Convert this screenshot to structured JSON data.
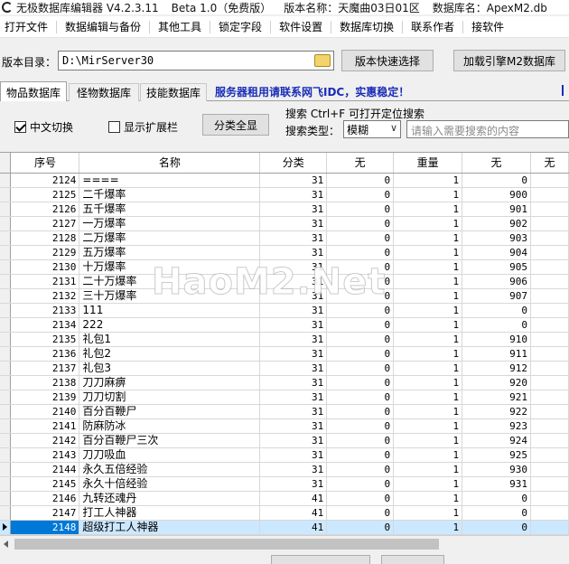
{
  "titlebar": {
    "app": "无极数据库编辑器 V4.2.3.11",
    "beta": "Beta 1.0（免费版）",
    "version_name": "版本名称：天魔曲03日01区",
    "db_name": "数据库名：ApexM2.db"
  },
  "menu": [
    "打开文件",
    "数据编辑与备份",
    "其他工具",
    "锁定字段",
    "软件设置",
    "数据库切换",
    "联系作者",
    "接软件"
  ],
  "directory": {
    "label": "版本目录：",
    "value": "D:\\MirServer30",
    "quick_select_label": "版本快速选择",
    "load_engine_label": "加载引擎M2数据库"
  },
  "tabs": [
    "物品数据库",
    "怪物数据库",
    "技能数据库"
  ],
  "banner": "服务器租用请联系网飞IDC，实惠稳定！",
  "options": {
    "chinese_toggle": "中文切换",
    "chinese_checked": true,
    "show_extension": "显示扩展栏",
    "show_extension_checked": false,
    "show_all_button": "分类全显"
  },
  "search": {
    "caption": "搜索  Ctrl+F 可打开定位搜索",
    "type_label": "搜索类型：",
    "type_value": "模糊",
    "placeholder": "请输入需要搜索的内容"
  },
  "table": {
    "columns": [
      "序号",
      "名称",
      "分类",
      "无",
      "重量",
      "无",
      "无"
    ],
    "rows": [
      [
        "2124",
        "====",
        "31",
        "0",
        "1",
        "0"
      ],
      [
        "2125",
        "二千爆率",
        "31",
        "0",
        "1",
        "900"
      ],
      [
        "2126",
        "五千爆率",
        "31",
        "0",
        "1",
        "901"
      ],
      [
        "2127",
        "一万爆率",
        "31",
        "0",
        "1",
        "902"
      ],
      [
        "2128",
        "二万爆率",
        "31",
        "0",
        "1",
        "903"
      ],
      [
        "2129",
        "五万爆率",
        "31",
        "0",
        "1",
        "904"
      ],
      [
        "2130",
        "十万爆率",
        "31",
        "0",
        "1",
        "905"
      ],
      [
        "2131",
        "二十万爆率",
        "31",
        "0",
        "1",
        "906"
      ],
      [
        "2132",
        "三十万爆率",
        "31",
        "0",
        "1",
        "907"
      ],
      [
        "2133",
        "111",
        "31",
        "0",
        "1",
        "0"
      ],
      [
        "2134",
        "222",
        "31",
        "0",
        "1",
        "0"
      ],
      [
        "2135",
        "礼包1",
        "31",
        "0",
        "1",
        "910"
      ],
      [
        "2136",
        "礼包2",
        "31",
        "0",
        "1",
        "911"
      ],
      [
        "2137",
        "礼包3",
        "31",
        "0",
        "1",
        "912"
      ],
      [
        "2138",
        "刀刀麻痹",
        "31",
        "0",
        "1",
        "920"
      ],
      [
        "2139",
        "刀刀切割",
        "31",
        "0",
        "1",
        "921"
      ],
      [
        "2140",
        "百分百鞭尸",
        "31",
        "0",
        "1",
        "922"
      ],
      [
        "2141",
        "防麻防冰",
        "31",
        "0",
        "1",
        "923"
      ],
      [
        "2142",
        "百分百鞭尸三次",
        "31",
        "0",
        "1",
        "924"
      ],
      [
        "2143",
        "刀刀吸血",
        "31",
        "0",
        "1",
        "925"
      ],
      [
        "2144",
        "永久五倍经验",
        "31",
        "0",
        "1",
        "930"
      ],
      [
        "2145",
        "永久十倍经验",
        "31",
        "0",
        "1",
        "931"
      ],
      [
        "2146",
        "九转还魂丹",
        "41",
        "0",
        "1",
        "0"
      ],
      [
        "2147",
        "打工人神器",
        "41",
        "0",
        "1",
        "0"
      ],
      [
        "2148",
        "超级打工人神器",
        "41",
        "0",
        "1",
        "0"
      ]
    ],
    "selected_index": 24
  },
  "watermark": "HaoM2.Net",
  "colors": {
    "banner": "#1a2db8",
    "selection": "#cce8ff",
    "selected_id": "#0078d7"
  }
}
